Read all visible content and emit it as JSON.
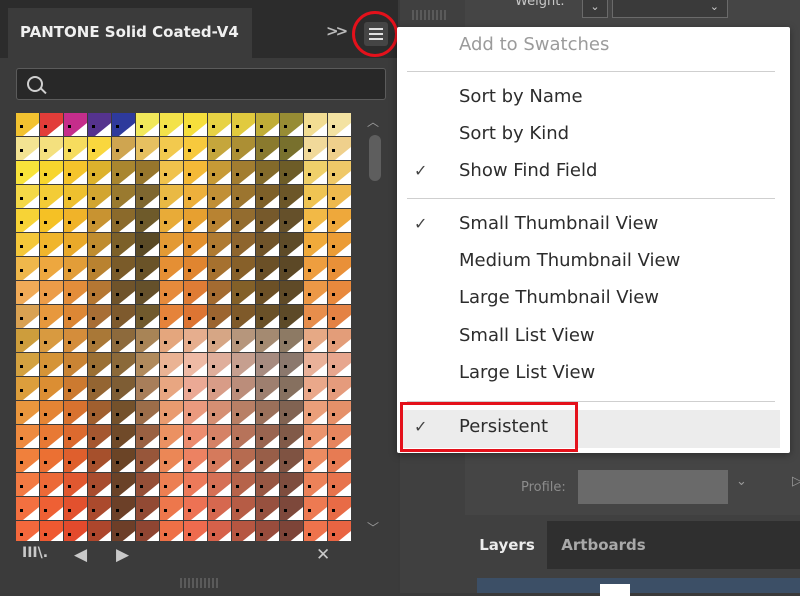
{
  "panel": {
    "title": "PANTONE Solid Coated-V4",
    "search_placeholder": "",
    "expand_glyph": ">>"
  },
  "props": {
    "weight_label": "Weight:",
    "profile_label": "Profile:"
  },
  "layers_panel": {
    "tabs": [
      "Layers",
      "Artboards"
    ]
  },
  "menu": {
    "items": [
      {
        "label": "Add to Swatches",
        "checked": false,
        "disabled": true
      },
      {
        "label": "Sort by Name",
        "checked": false,
        "disabled": false
      },
      {
        "label": "Sort by Kind",
        "checked": false,
        "disabled": false
      },
      {
        "label": "Show Find Field",
        "checked": true,
        "disabled": false
      },
      {
        "label": "Small Thumbnail View",
        "checked": true,
        "disabled": false
      },
      {
        "label": "Medium Thumbnail View",
        "checked": false,
        "disabled": false
      },
      {
        "label": "Large Thumbnail View",
        "checked": false,
        "disabled": false
      },
      {
        "label": "Small List View",
        "checked": false,
        "disabled": false
      },
      {
        "label": "Large List View",
        "checked": false,
        "disabled": false
      },
      {
        "label": "Persistent",
        "checked": true,
        "disabled": false
      }
    ],
    "check_glyph": "✓"
  },
  "swatches": {
    "rows": [
      [
        "#f2c230",
        "#e23d39",
        "#c52d8b",
        "#55338e",
        "#2e3a9c",
        "#f1e85a",
        "#f3e24a",
        "#f6df3c",
        "#e7d244",
        "#e1ca3e",
        "#c0ad37",
        "#978c34",
        "#f2dd93",
        "#f3e2a2"
      ],
      [
        "#f3e392",
        "#f4e07e",
        "#f6dc5e",
        "#f9d73e",
        "#cfa550",
        "#e6c060",
        "#f2c94e",
        "#f7c93d",
        "#c5a63c",
        "#ac8f34",
        "#8a7a2e",
        "#78702d",
        "#f1d99a",
        "#efd08c"
      ],
      [
        "#f8e33a",
        "#f7d52d",
        "#f5c42b",
        "#ddb22c",
        "#a9862f",
        "#97762c",
        "#f0c24c",
        "#f4b937",
        "#c79a36",
        "#a27d30",
        "#836a2a",
        "#6d5c27",
        "#efd06a",
        "#efc868"
      ],
      [
        "#f4d847",
        "#f3cc36",
        "#eec02f",
        "#d2a530",
        "#9a7a2f",
        "#7f6730",
        "#e9b944",
        "#edb03c",
        "#c18f36",
        "#9c752f",
        "#7e6029",
        "#6c5628",
        "#efc453",
        "#eeb94d"
      ],
      [
        "#f7d336",
        "#f5c125",
        "#f0b329",
        "#c89331",
        "#8b6a2b",
        "#6e5a2a",
        "#e8ab38",
        "#e7a030",
        "#b88332",
        "#936c2f",
        "#76592b",
        "#65502a",
        "#f2b946",
        "#eea83b"
      ],
      [
        "#f4c73a",
        "#f0b52c",
        "#e9a92a",
        "#bf8c2f",
        "#7c6029",
        "#5a4a26",
        "#e39a34",
        "#e2902e",
        "#af7a31",
        "#8e652e",
        "#70542a",
        "#5e4b28",
        "#f0aa3b",
        "#eb9c36"
      ],
      [
        "#efb74b",
        "#eda73f",
        "#e29d38",
        "#b98230",
        "#7a5b29",
        "#6a5328",
        "#e58f34",
        "#e08530",
        "#a6712f",
        "#876029",
        "#6b5027",
        "#5c4826",
        "#ee9e3f",
        "#e99038"
      ],
      [
        "#f0aa57",
        "#ec9c48",
        "#e38d3a",
        "#b57733",
        "#6f532a",
        "#65502a",
        "#e68a3b",
        "#df7c35",
        "#a36b31",
        "#836028",
        "#6c5026",
        "#5f4a27",
        "#ec9846",
        "#e8893d"
      ],
      [
        "#d9a152",
        "#e7983d",
        "#dc8735",
        "#a86e35",
        "#7e5a2d",
        "#715a2d",
        "#e5833a",
        "#dd7533",
        "#9c6530",
        "#7f5a2a",
        "#6a5128",
        "#5d4a28",
        "#e78e4c",
        "#e48244"
      ],
      [
        "#cd9d3c",
        "#d89a40",
        "#d48d3b",
        "#a97837",
        "#8d6a3c",
        "#a88456",
        "#e4a67d",
        "#e6ae8e",
        "#d6a685",
        "#b6967c",
        "#a48a71",
        "#8d7a64",
        "#e6a985",
        "#e39d79"
      ],
      [
        "#d3a140",
        "#d59437",
        "#c98434",
        "#9a6f33",
        "#8b6939",
        "#b08a5c",
        "#eab394",
        "#eebaa5",
        "#dfae9b",
        "#c69f8f",
        "#a68b80",
        "#8b786d",
        "#e9b199",
        "#e7a68e"
      ],
      [
        "#dc9e3c",
        "#db8e33",
        "#cc7a30",
        "#946532",
        "#7e5d34",
        "#a87e5a",
        "#e8a681",
        "#eba995",
        "#d89c87",
        "#bb8d7a",
        "#9e7f6f",
        "#86705f",
        "#eaa88a",
        "#e59b7c"
      ],
      [
        "#e9963d",
        "#e48434",
        "#d8722f",
        "#a05f2f",
        "#74512b",
        "#9c6d49",
        "#e99b6f",
        "#ea9a7e",
        "#d58f73",
        "#b87f65",
        "#9a705a",
        "#816352",
        "#ea9f7a",
        "#e59069"
      ],
      [
        "#ee8a3f",
        "#e87934",
        "#dc6a2f",
        "#a55730",
        "#704a29",
        "#9a6142",
        "#eb9162",
        "#ec8d6f",
        "#d58266",
        "#b7735a",
        "#996550",
        "#815a48",
        "#eb946d",
        "#e6855e"
      ],
      [
        "#f0803c",
        "#eb7033",
        "#df5f2d",
        "#a6502c",
        "#6b4426",
        "#97563a",
        "#eb8756",
        "#ec8262",
        "#d57a5c",
        "#b66b50",
        "#985e48",
        "#7f5342",
        "#ec8b61",
        "#e77b53"
      ],
      [
        "#f27a43",
        "#ec6937",
        "#e05830",
        "#a84c2e",
        "#6a4227",
        "#954f37",
        "#ec7f52",
        "#ec7a5a",
        "#d57055",
        "#b6634a",
        "#975743",
        "#7e4d3e",
        "#ec8259",
        "#e7734c"
      ],
      [
        "#f37040",
        "#ee6034",
        "#e2512e",
        "#ab4a2d",
        "#6c4028",
        "#924a34",
        "#ed774c",
        "#ed7254",
        "#d6684f",
        "#b65c45",
        "#97513f",
        "#7d483b",
        "#ed7a52",
        "#e86b46"
      ],
      [
        "#f4683c",
        "#ef5931",
        "#e34a2c",
        "#ad462c",
        "#6d3e28",
        "#8f4532",
        "#ee7046",
        "#ee6b4e",
        "#d6614a",
        "#b65641",
        "#984c3c",
        "#7d4438",
        "#ee734c",
        "#e96442"
      ]
    ]
  }
}
